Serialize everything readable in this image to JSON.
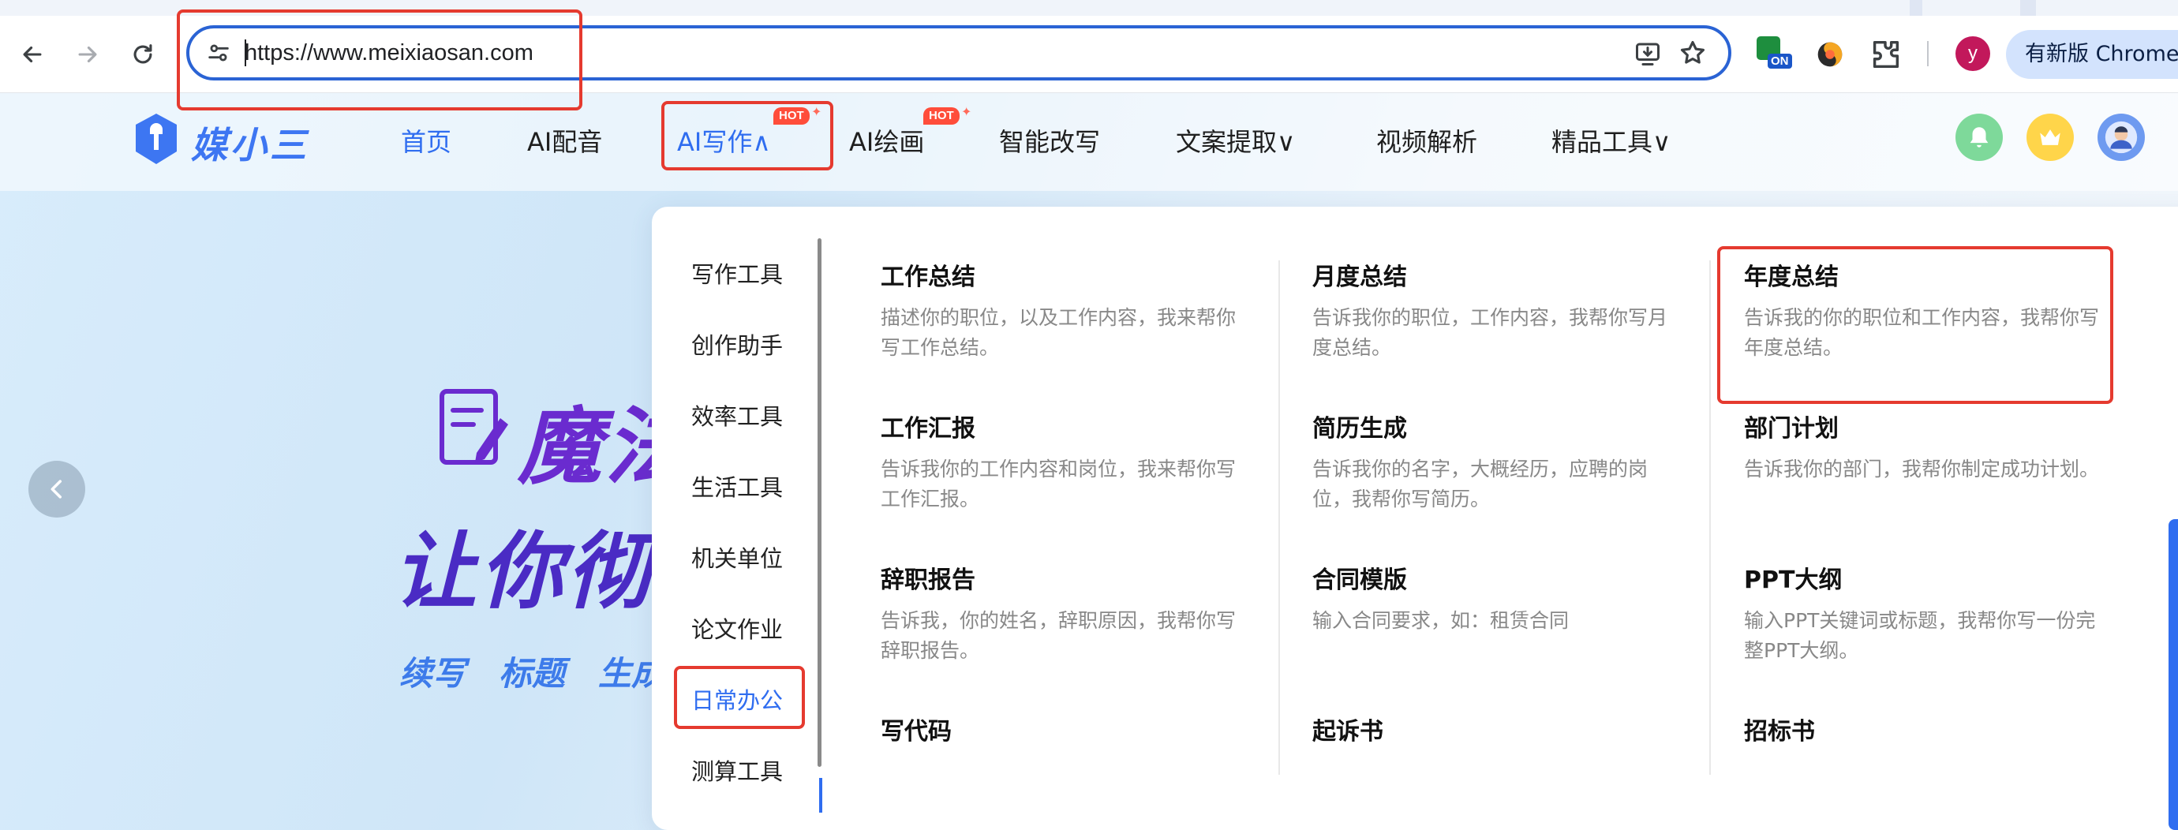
{
  "browser": {
    "url": "https://www.meixiaosan.com",
    "profile_initial": "y",
    "ext_badge": "ON",
    "update_label": "有新版 Chrome 可用"
  },
  "site": {
    "logo_text": "媒小三",
    "nav": [
      {
        "label": "首页",
        "active": true
      },
      {
        "label": "AI配音"
      },
      {
        "label": "AI写作∧",
        "hot": "HOT"
      },
      {
        "label": "AI绘画",
        "hot": "HOT"
      },
      {
        "label": "智能改写"
      },
      {
        "label": "文案提取∨"
      },
      {
        "label": "视频解析"
      },
      {
        "label": "精品工具∨"
      }
    ]
  },
  "hero": {
    "line1": "魔法",
    "line2": "让你彻底",
    "tags": [
      "续写",
      "标题",
      "生成"
    ]
  },
  "dropdown": {
    "categories": [
      "写作工具",
      "创作助手",
      "效率工具",
      "生活工具",
      "机关单位",
      "论文作业",
      "日常办公",
      "测算工具"
    ],
    "active_category": "日常办公",
    "cards": [
      {
        "title": "工作总结",
        "desc": "描述你的职位，以及工作内容，我来帮你写工作总结。"
      },
      {
        "title": "月度总结",
        "desc": "告诉我你的职位，工作内容，我帮你写月度总结。"
      },
      {
        "title": "年度总结",
        "desc": "告诉我的你的职位和工作内容，我帮你写年度总结。"
      },
      {
        "title": "工作汇报",
        "desc": "告诉我你的工作内容和岗位，我来帮你写工作汇报。"
      },
      {
        "title": "简历生成",
        "desc": "告诉我你的名字，大概经历，应聘的岗位，我帮你写简历。"
      },
      {
        "title": "部门计划",
        "desc": "告诉我你的部门，我帮你制定成功计划。"
      },
      {
        "title": "辞职报告",
        "desc": "告诉我，你的姓名，辞职原因，我帮你写辞职报告。"
      },
      {
        "title": "合同模版",
        "desc": "输入合同要求，如：租赁合同"
      },
      {
        "title": "PPT大纲",
        "desc": "输入PPT关键词或标题，我帮你写一份完整PPT大纲。"
      },
      {
        "title": "写代码",
        "desc": ""
      },
      {
        "title": "起诉书",
        "desc": ""
      },
      {
        "title": "招标书",
        "desc": ""
      }
    ]
  }
}
